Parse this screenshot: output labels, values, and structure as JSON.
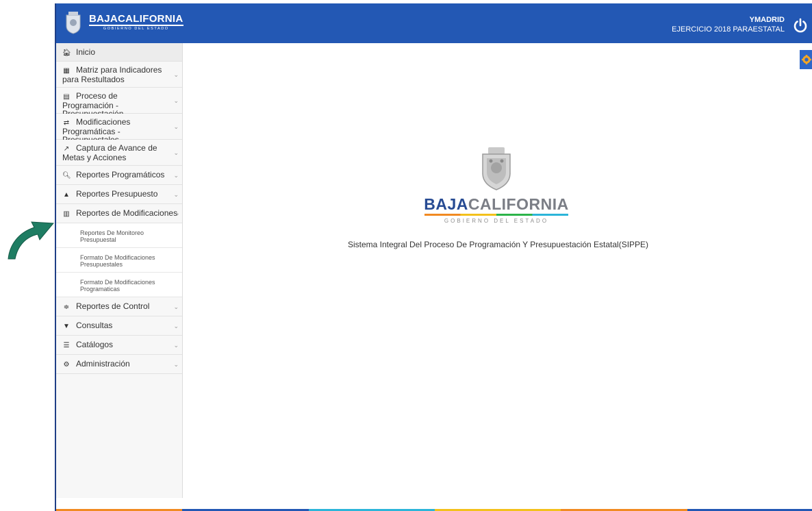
{
  "header": {
    "brand_main": "BAJACALIFORNIA",
    "brand_sub": "GOBIERNO DEL ESTADO",
    "user_name": "YMADRID",
    "exercise": "EJERCICIO 2018 PARAESTATAL"
  },
  "sidebar": {
    "items": [
      {
        "label": "Inicio"
      },
      {
        "label": "Matriz para Indicadores para Restultados"
      },
      {
        "label": "Proceso de Programación - Presupuestación"
      },
      {
        "label": "Modificaciones Programáticas - Presupuestales"
      },
      {
        "label": "Captura de Avance de Metas y Acciones"
      },
      {
        "label": "Reportes Programáticos"
      },
      {
        "label": "Reportes Presupuesto"
      },
      {
        "label": "Reportes de Modificaciones"
      },
      {
        "label": "Reportes de Control"
      },
      {
        "label": "Consultas"
      },
      {
        "label": "Catálogos"
      },
      {
        "label": "Administración"
      }
    ],
    "subitems": [
      {
        "label": "Reportes De Monitoreo Presupuestal"
      },
      {
        "label": "Formato De Modificaciones Presupuestales"
      },
      {
        "label": "Formato De Modificaciones Programaticas"
      }
    ]
  },
  "main": {
    "brand_part1": "BAJA",
    "brand_part2": "CALIFORNIA",
    "brand_sub": "GOBIERNO DEL ESTADO",
    "system_title": "Sistema Integral Del Proceso De Programación Y Presupuestación Estatal(SIPPE)"
  },
  "colors": {
    "header_bg": "#2358b4",
    "accent_orange": "#f18a22",
    "accent_yellow": "#f3c11c",
    "accent_green": "#2db44a",
    "accent_cyan": "#2cb5d9",
    "arrow_green": "#1f7d63"
  }
}
